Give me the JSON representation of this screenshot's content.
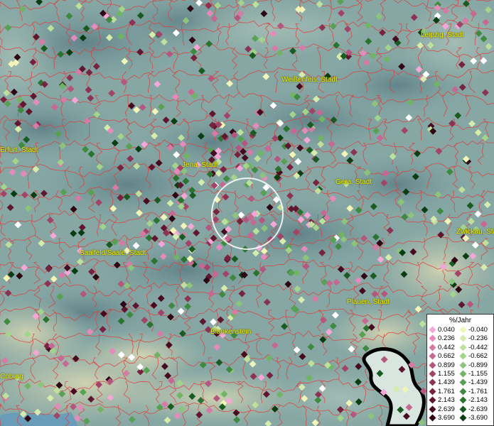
{
  "map": {
    "cities": [
      {
        "name": "Leipzig, Stadt"
      },
      {
        "name": "Weißenfels, Stadt"
      },
      {
        "name": "Erfurt, Stadt"
      },
      {
        "name": "Jena, Stadt"
      },
      {
        "name": "Gera, Stadt"
      },
      {
        "name": "Zwickau, Stadt"
      },
      {
        "name": "Saalfeld/Saale, Stadt"
      },
      {
        "name": "Plauen, Stadt"
      },
      {
        "name": "Blankenstein"
      },
      {
        "name": "Coburg"
      }
    ]
  },
  "legend": {
    "title": "%/Jahr",
    "rows": [
      {
        "pos": "0.040",
        "neg": "-0.040",
        "pos_color": "#f4a6d6",
        "neg_color": "#f1f5b8"
      },
      {
        "pos": "0.236",
        "neg": "-0.236",
        "pos_color": "#e58bbb",
        "neg_color": "#d5ecad"
      },
      {
        "pos": "0.442",
        "neg": "-0.442",
        "pos_color": "#d67aa6",
        "neg_color": "#bde19d"
      },
      {
        "pos": "0.662",
        "neg": "-0.662",
        "pos_color": "#c66892",
        "neg_color": "#a3d48b"
      },
      {
        "pos": "0.899",
        "neg": "-0.899",
        "pos_color": "#b4567d",
        "neg_color": "#8bc47a"
      },
      {
        "pos": "1.155",
        "neg": "-1.155",
        "pos_color": "#a14468",
        "neg_color": "#72b466"
      },
      {
        "pos": "1.439",
        "neg": "-1.439",
        "pos_color": "#8c3354",
        "neg_color": "#58a053"
      },
      {
        "pos": "1.761",
        "neg": "-1.761",
        "pos_color": "#772340",
        "neg_color": "#3e8a41"
      },
      {
        "pos": "2.143",
        "neg": "-2.143",
        "pos_color": "#5f162f",
        "neg_color": "#2a7331"
      },
      {
        "pos": "2.639",
        "neg": "-2.639",
        "pos_color": "#470b20",
        "neg_color": "#195b22"
      },
      {
        "pos": "3.690",
        "neg": "-3.690",
        "pos_color": "#2e0513",
        "neg_color": "#0b3d14"
      }
    ]
  }
}
